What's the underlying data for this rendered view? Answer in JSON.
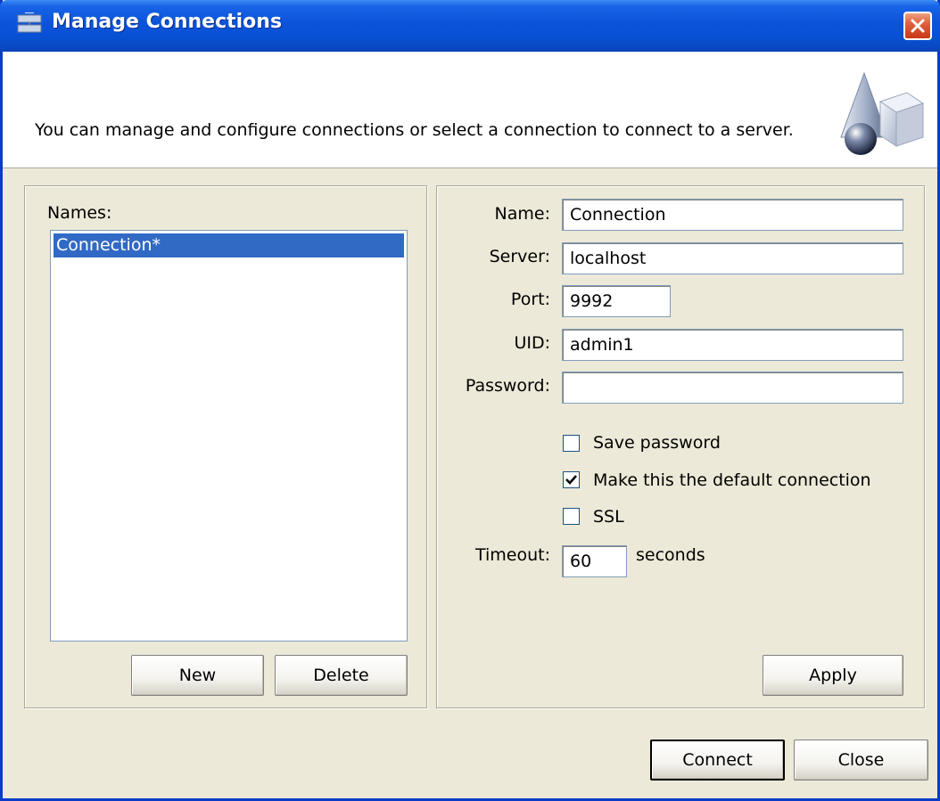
{
  "window": {
    "title": "Manage Connections",
    "description": "You can manage and configure connections or select a connection to connect to a server."
  },
  "names_panel": {
    "label": "Names:",
    "items": [
      "Connection*"
    ],
    "selected_index": 0,
    "new_button": "New",
    "delete_button": "Delete"
  },
  "details_panel": {
    "name_label": "Name:",
    "name_value": "Connection",
    "server_label": "Server:",
    "server_value": "localhost",
    "port_label": "Port:",
    "port_value": "9992",
    "uid_label": "UID:",
    "uid_value": "admin1",
    "password_label": "Password:",
    "password_value": "",
    "save_password_label": "Save password",
    "save_password_checked": false,
    "default_connection_label": "Make this the default connection",
    "default_connection_checked": true,
    "ssl_label": "SSL",
    "ssl_checked": false,
    "timeout_label": "Timeout:",
    "timeout_value": "60",
    "timeout_unit": "seconds",
    "apply_button": "Apply"
  },
  "footer": {
    "connect_button": "Connect",
    "close_button": "Close"
  },
  "colors": {
    "titlebar": "#0b54da",
    "selection": "#316ac5",
    "dialog_bg": "#ece9d8",
    "close_button": "#e06040"
  },
  "icons": {
    "title": "network-connection-icon",
    "close": "close-icon",
    "header": "3d-shapes-icon",
    "check": "checkmark-icon"
  }
}
